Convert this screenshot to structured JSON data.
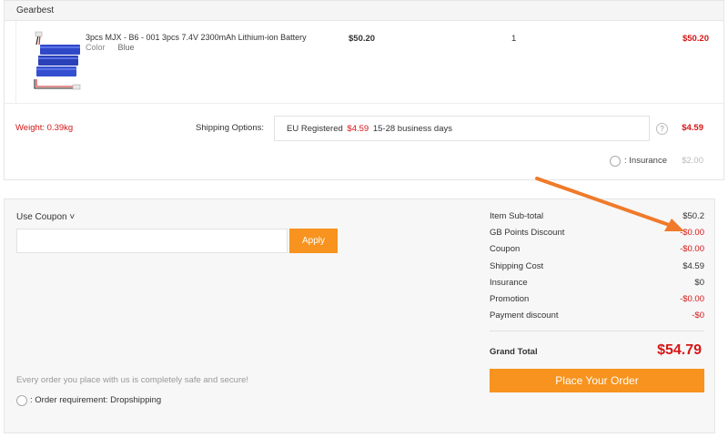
{
  "store": {
    "name": "Gearbest"
  },
  "product": {
    "name": "3pcs MJX - B6 - 001 3pcs 7.4V 2300mAh Lithium-ion Battery",
    "color_label": "Color",
    "color_value": "Blue",
    "price": "$50.20",
    "quantity": "1",
    "total": "$50.20"
  },
  "shipping": {
    "weight": "Weight: 0.39kg",
    "options_label": "Shipping Options:",
    "method": "EU Registered",
    "method_price": "$4.59",
    "method_days": "15-28 business days",
    "help_icon": "?",
    "cost": "$4.59",
    "insurance_label": ": Insurance",
    "insurance_cost": "$2.00"
  },
  "coupon": {
    "label": "Use Coupon ˅",
    "placeholder": "",
    "apply_label": "Apply"
  },
  "totals": {
    "rows": [
      {
        "label": "Item Sub-total",
        "value": "$50.2"
      },
      {
        "label": "GB Points Discount",
        "value": "-$0.00"
      },
      {
        "label": "Coupon",
        "value": "-$0.00"
      },
      {
        "label": "Shipping Cost",
        "value": "$4.59"
      },
      {
        "label": "Insurance",
        "value": "$0"
      },
      {
        "label": "Promotion",
        "value": "-$0.00"
      },
      {
        "label": "Payment discount",
        "value": "-$0"
      }
    ],
    "grand_label": "Grand Total",
    "grand_value": "$54.79"
  },
  "footer": {
    "safe_text": "Every order you place with us is completely safe and secure!",
    "dropship_label": ": Order requirement: Dropshipping"
  },
  "place_order_label": "Place Your Order",
  "colors": {
    "accent": "#f7931e",
    "price_red": "#d61616",
    "arrow": "#f07a2a"
  },
  "icons": {
    "help": "question-circle-icon",
    "product_image": "battery-pack-icon"
  }
}
